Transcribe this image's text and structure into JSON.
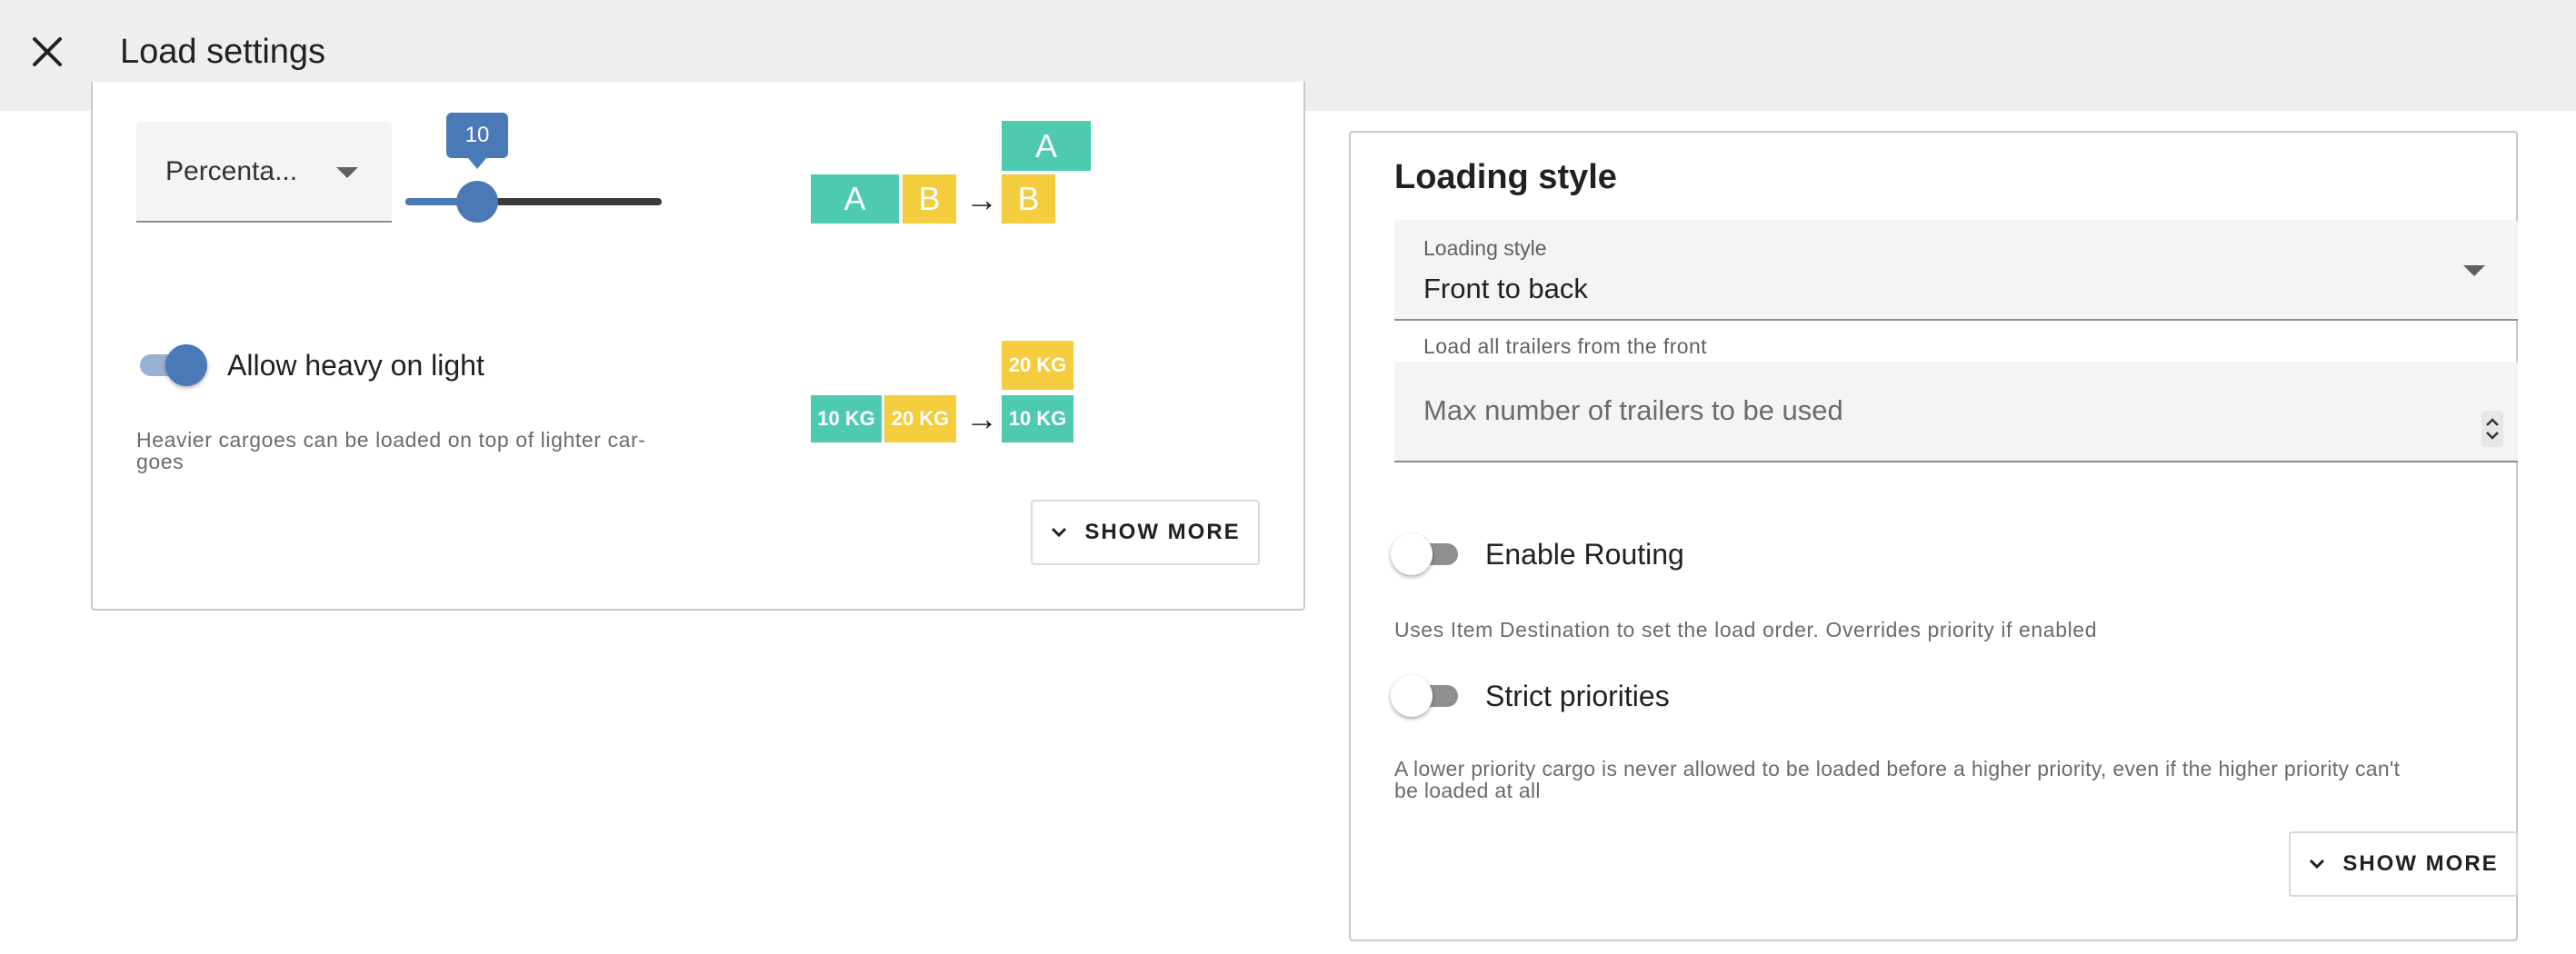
{
  "header": {
    "title": "Load settings",
    "close_icon": "close-icon"
  },
  "left_card": {
    "unit_select": {
      "value": "Percenta..."
    },
    "slider": {
      "value": 10,
      "display": "10",
      "fraction": 0.28
    },
    "diagram1": {
      "bottom_left": "A",
      "bottom_right": "B",
      "arrow": "→",
      "top_result": "A",
      "bottom_result": "B"
    },
    "heavy_toggle": {
      "label": "Allow heavy on light",
      "on": true
    },
    "heavy_desc_line1": "Heavier cargoes can be loaded on top of lighter car-",
    "heavy_desc_line2": "goes",
    "diagram2": {
      "bottom_left": "10 KG",
      "bottom_right": "20 KG",
      "arrow": "→",
      "top_result": "20 KG",
      "bottom_result": "10 KG"
    },
    "show_more": "SHOW MORE"
  },
  "right_card": {
    "title": "Loading style",
    "loading_style_field": {
      "label": "Loading style",
      "value": "Front to back",
      "helper": "Load all trailers from the front"
    },
    "max_trailers_field": {
      "placeholder": "Max number of trailers to be used"
    },
    "routing_toggle": {
      "label": "Enable Routing",
      "on": false
    },
    "routing_desc": "Uses Item Destination to set the load order. Overrides priority if enabled",
    "priorities_toggle": {
      "label": "Strict priorities",
      "on": false
    },
    "priorities_desc_line1": "A lower priority cargo is never allowed to be loaded before a higher priority, even if the higher priority can't",
    "priorities_desc_line2": "be loaded at all",
    "show_more": "SHOW MORE"
  },
  "colors": {
    "accent": "#4a79b7",
    "cargo_a": "#4dcab0",
    "cargo_b": "#f3cd3d",
    "header_bg": "#eeeeee"
  }
}
